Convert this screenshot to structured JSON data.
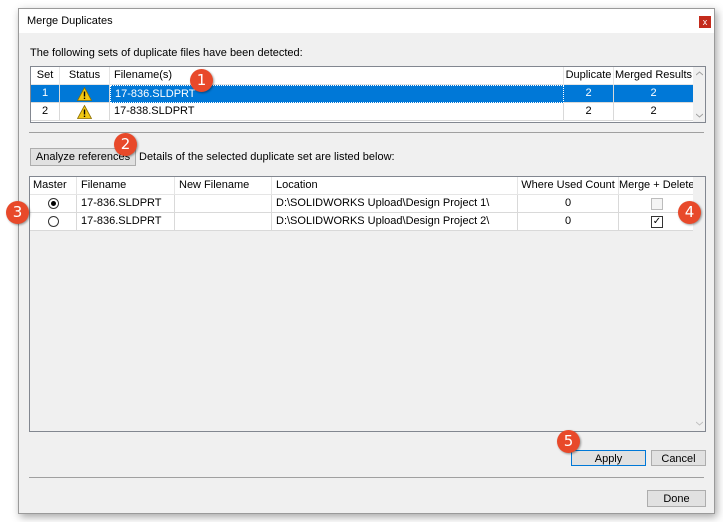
{
  "window": {
    "title": "Merge Duplicates",
    "close_label": "x"
  },
  "sets_caption": "The following sets of duplicate files have been detected:",
  "sets_table": {
    "headers": [
      "Set",
      "Status",
      "Filename(s)",
      "Duplicate",
      "Merged Results"
    ],
    "rows": [
      {
        "set": "1",
        "status_icon": "warning-icon",
        "filename": "17-836.SLDPRT",
        "duplicate": "2",
        "merged": "2",
        "selected": true
      },
      {
        "set": "2",
        "status_icon": "warning-icon",
        "filename": "17-838.SLDPRT",
        "duplicate": "2",
        "merged": "2",
        "selected": false
      }
    ]
  },
  "analyze_button": "Analyze references",
  "details_caption": "Details of the selected duplicate set are listed below:",
  "details_table": {
    "headers": [
      "Master",
      "Filename",
      "New Filename",
      "Location",
      "Where Used Count",
      "Merge + Delete"
    ],
    "rows": [
      {
        "master": true,
        "filename": "17-836.SLDPRT",
        "new_filename": "",
        "location": "D:\\SOLIDWORKS Upload\\Design Project 1\\",
        "where_used": "0",
        "merge_delete": false,
        "merge_disabled": true
      },
      {
        "master": false,
        "filename": "17-836.SLDPRT",
        "new_filename": "",
        "location": "D:\\SOLIDWORKS Upload\\Design Project 2\\",
        "where_used": "0",
        "merge_delete": true,
        "merge_disabled": false
      }
    ]
  },
  "buttons": {
    "apply": "Apply",
    "cancel": "Cancel",
    "done": "Done"
  },
  "callouts": [
    "1",
    "2",
    "3",
    "4",
    "5"
  ],
  "colors": {
    "selection": "#0078d7",
    "callout": "#e8492a",
    "warning": "#f2c811"
  }
}
